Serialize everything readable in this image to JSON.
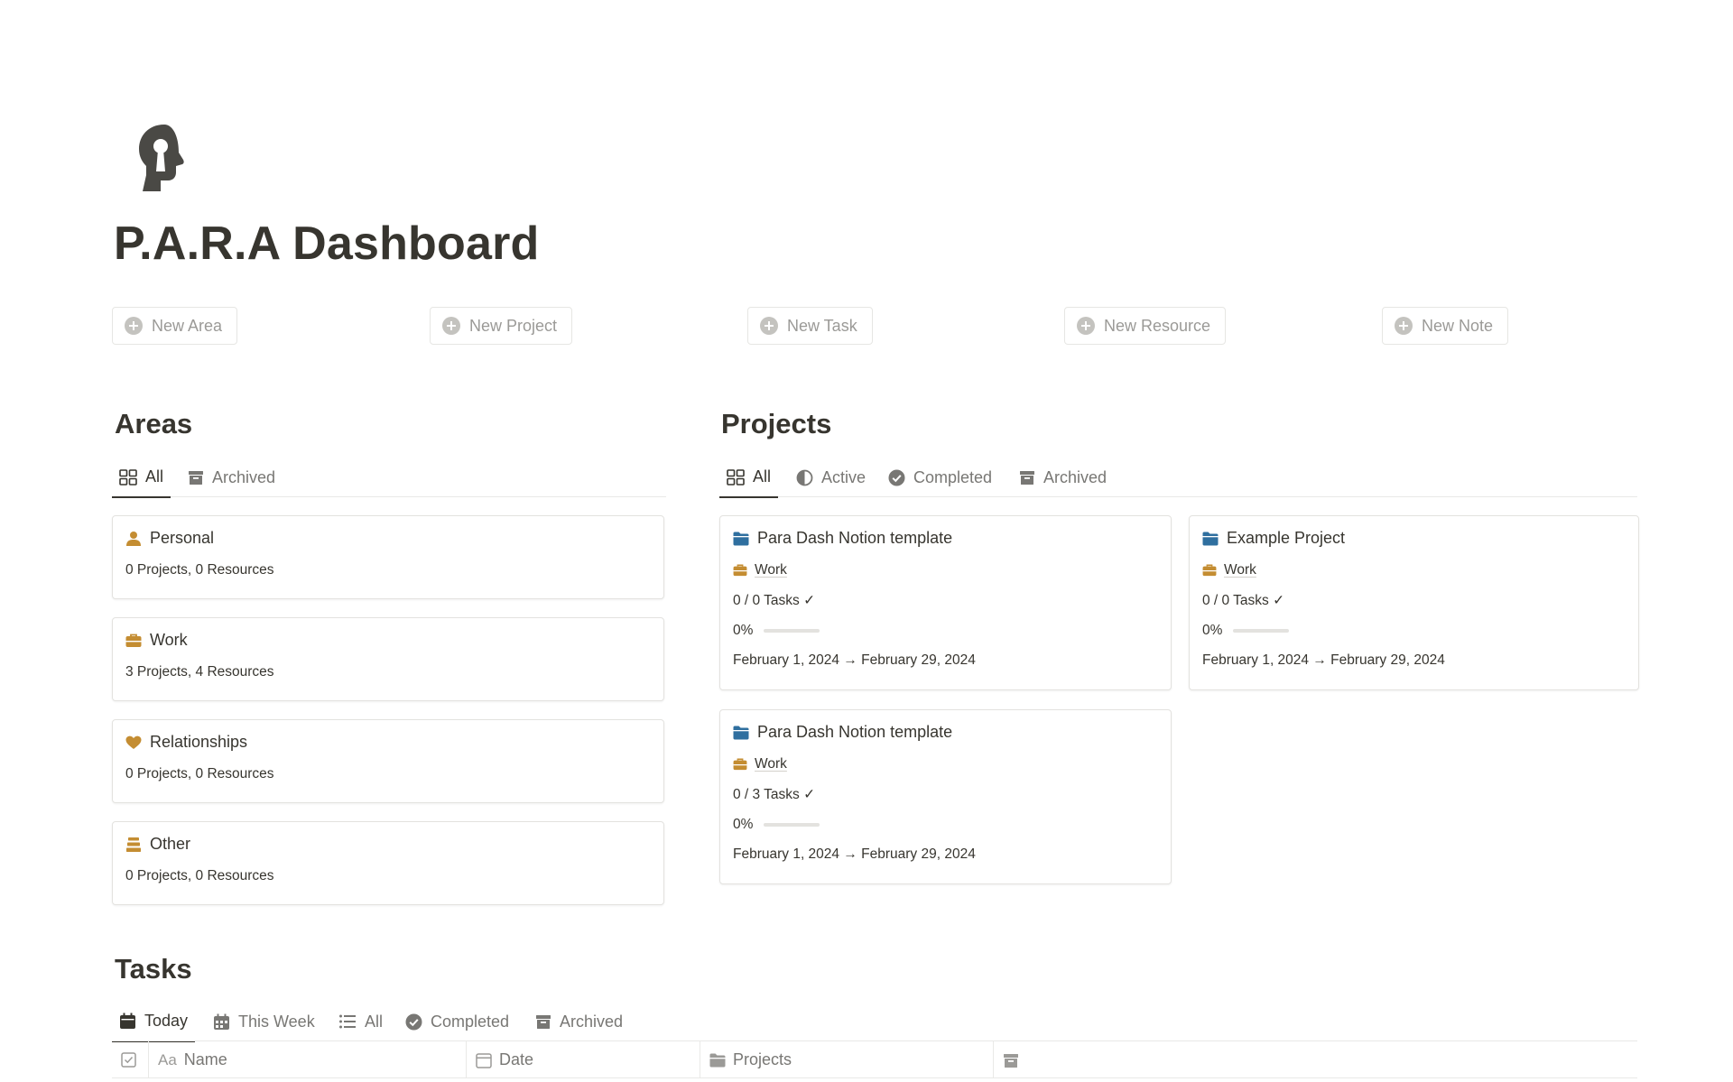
{
  "page": {
    "title": "P.A.R.A Dashboard",
    "icon": "head-keyhole-icon"
  },
  "buttons": [
    {
      "label": "New Area"
    },
    {
      "label": "New Project"
    },
    {
      "label": "New Task"
    },
    {
      "label": "New Resource"
    },
    {
      "label": "New Note"
    }
  ],
  "areas": {
    "title": "Areas",
    "tabs": [
      {
        "label": "All",
        "icon": "gallery-icon",
        "active": true
      },
      {
        "label": "Archived",
        "icon": "archive-icon",
        "active": false
      }
    ],
    "cards": [
      {
        "name": "Personal",
        "icon": "person-icon",
        "summary": "0 Projects, 0 Resources"
      },
      {
        "name": "Work",
        "icon": "briefcase-icon",
        "summary": "3 Projects, 4 Resources"
      },
      {
        "name": "Relationships",
        "icon": "heart-icon",
        "summary": "0 Projects, 0 Resources"
      },
      {
        "name": "Other",
        "icon": "stack-icon",
        "summary": "0 Projects, 0 Resources"
      }
    ]
  },
  "projects": {
    "title": "Projects",
    "tabs": [
      {
        "label": "All",
        "icon": "gallery-icon",
        "active": true
      },
      {
        "label": "Active",
        "icon": "half-circle-icon",
        "active": false
      },
      {
        "label": "Completed",
        "icon": "check-circle-icon",
        "active": false
      },
      {
        "label": "Archived",
        "icon": "archive-icon",
        "active": false
      }
    ],
    "cards": [
      {
        "name": "Para Dash Notion template",
        "area": "Work",
        "tasks": "0 / 0 Tasks ✓",
        "progress_label": "0%",
        "progress": 0,
        "dates": "February 1, 2024 → February 29, 2024"
      },
      {
        "name": "Example Project",
        "area": "Work",
        "tasks": "0 / 0 Tasks ✓",
        "progress_label": "0%",
        "progress": 0,
        "dates": "February 1, 2024 → February 29, 2024"
      },
      {
        "name": "Para Dash Notion template",
        "area": "Work",
        "tasks": "0 / 3 Tasks ✓",
        "progress_label": "0%",
        "progress": 0,
        "dates": "February 1, 2024 → February 29, 2024"
      }
    ]
  },
  "tasks": {
    "title": "Tasks",
    "tabs": [
      {
        "label": "Today",
        "icon": "calendar-icon",
        "active": true
      },
      {
        "label": "This Week",
        "icon": "calendar-week-icon",
        "active": false
      },
      {
        "label": "All",
        "icon": "list-icon",
        "active": false
      },
      {
        "label": "Completed",
        "icon": "check-circle-icon",
        "active": false
      },
      {
        "label": "Archived",
        "icon": "archive-icon",
        "active": false
      }
    ],
    "columns": [
      {
        "label": "",
        "icon": "checkbox-icon"
      },
      {
        "label": "Name",
        "prefix": "Aa",
        "icon": "text-icon"
      },
      {
        "label": "Date",
        "icon": "calendar-outline-icon"
      },
      {
        "label": "Projects",
        "icon": "folder-icon"
      },
      {
        "label": "",
        "icon": "archive-icon"
      }
    ]
  },
  "colors": {
    "text": "#37352f",
    "muted": "#787774",
    "area_icon": "#c48d32",
    "folder_icon": "#2f6f9f",
    "progress": "#2f80ed"
  }
}
